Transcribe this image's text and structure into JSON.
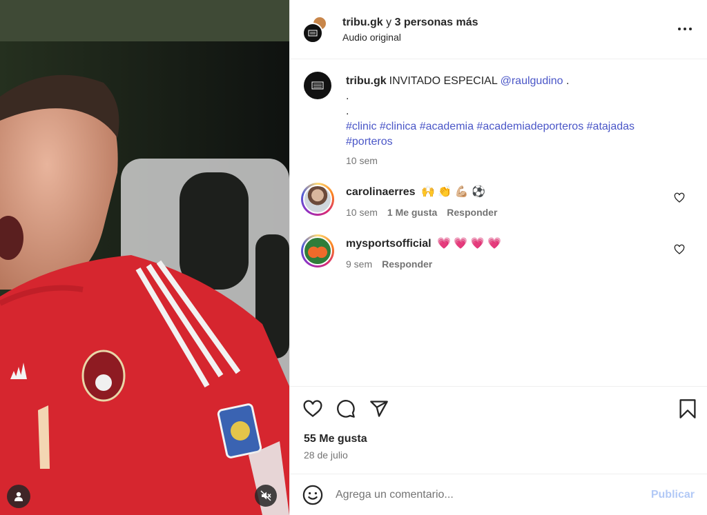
{
  "header": {
    "username": "tribu.gk",
    "connector": " y ",
    "others": "3 personas más",
    "audio": "Audio original"
  },
  "caption": {
    "username": "tribu.gk",
    "text": "INVITADO ESPECIAL",
    "mention": "@raulgudino",
    "after_mention": " .",
    "line_dot_1": ".",
    "line_dot_2": ".",
    "hashtags_line1": "#clinic #clinica #academia #academiadeporteros #atajadas",
    "hashtags_line2": "#porteros",
    "time": "10 sem"
  },
  "comments": [
    {
      "username": "carolinaerres",
      "text": "🙌 👏 💪🏼 ⚽",
      "time": "10 sem",
      "likes": "1 Me gusta",
      "reply": "Responder"
    },
    {
      "username": "mysportsofficial",
      "text": "💗 💗 💗 💗",
      "time": "9 sem",
      "reply": "Responder"
    }
  ],
  "footer": {
    "likes": "55 Me gusta",
    "date": "28 de julio"
  },
  "composer": {
    "placeholder": "Agrega un comentario...",
    "publish": "Publicar"
  },
  "icons": {
    "more": "more-icon",
    "like": "heart-icon",
    "comment": "comment-icon",
    "share": "share-icon",
    "save": "bookmark-icon",
    "emoji": "emoji-icon",
    "mute": "muted-icon",
    "tag": "user-tag-icon"
  },
  "colors": {
    "link": "#4a56c7",
    "muted": "#737373",
    "publish": "#b2c9f6",
    "jersey": "#d6262f"
  }
}
